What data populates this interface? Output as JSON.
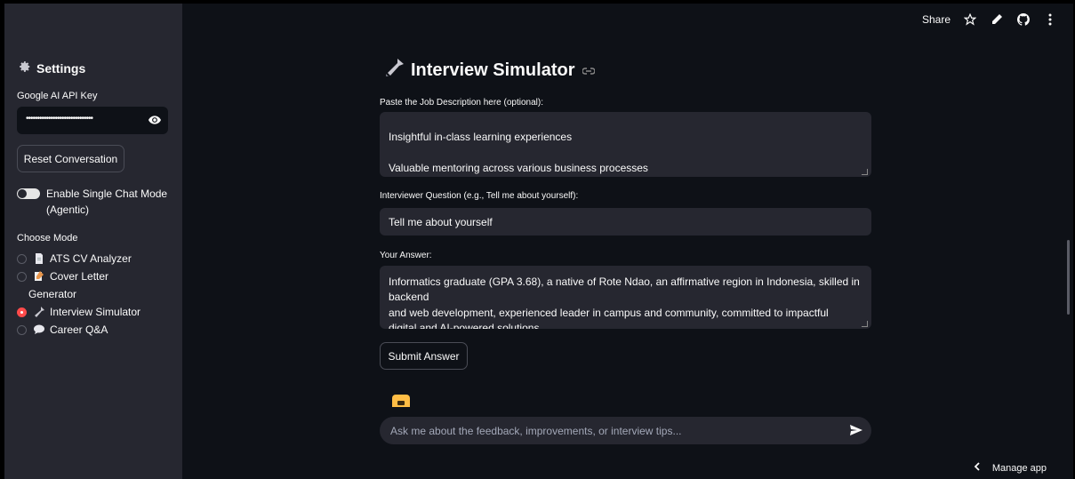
{
  "toolbar": {
    "share_label": "Share",
    "icons": [
      "star-icon",
      "pencil-icon",
      "github-icon",
      "more-vertical-icon"
    ]
  },
  "sidebar": {
    "title": "Settings",
    "title_icon": "gear-icon",
    "api_key_label": "Google AI API Key",
    "api_key_value": "••••••••••••••••••••••••••••••",
    "reset_label": "Reset Conversation",
    "toggle_label_line1": "Enable Single Chat Mode",
    "toggle_label_line2": "(Agentic)",
    "toggle_on": false,
    "mode_label": "Choose Mode",
    "modes": [
      {
        "label": "ATS CV Analyzer",
        "icon": "document-icon",
        "selected": false
      },
      {
        "label": "Cover Letter",
        "label2": "Generator",
        "icon": "memo-icon",
        "selected": false
      },
      {
        "label": "Interview Simulator",
        "icon": "microphone-icon",
        "selected": true
      },
      {
        "label": "Career Q&A",
        "icon": "speech-bubble-icon",
        "selected": false
      }
    ]
  },
  "main": {
    "title": "Interview Simulator",
    "title_icon": "microphone-icon",
    "jd_label": "Paste the Job Description here (optional):",
    "jd_lines": [
      "Insightful in-class learning experiences",
      "Valuable mentoring across various business processes"
    ],
    "question_label": "Interviewer Question (e.g., Tell me about yourself):",
    "question_value": "Tell me about yourself",
    "answer_label": "Your Answer:",
    "answer_lines": [
      "Informatics graduate (GPA 3.68), a native of Rote Ndao, an affirmative region in Indonesia, skilled in",
      "backend",
      "and web development, experienced leader in campus and community, committed to impactful",
      "digital and AI‑powered solutions"
    ],
    "submit_label": "Submit Answer",
    "chat_placeholder": "Ask me about the feedback, improvements, or interview tips..."
  },
  "footer": {
    "manage_label": "Manage app"
  },
  "colors": {
    "accent": "#ff4b4b",
    "background": "#0e1117",
    "sidebar": "#262730",
    "avatar": "#ffbd45"
  }
}
